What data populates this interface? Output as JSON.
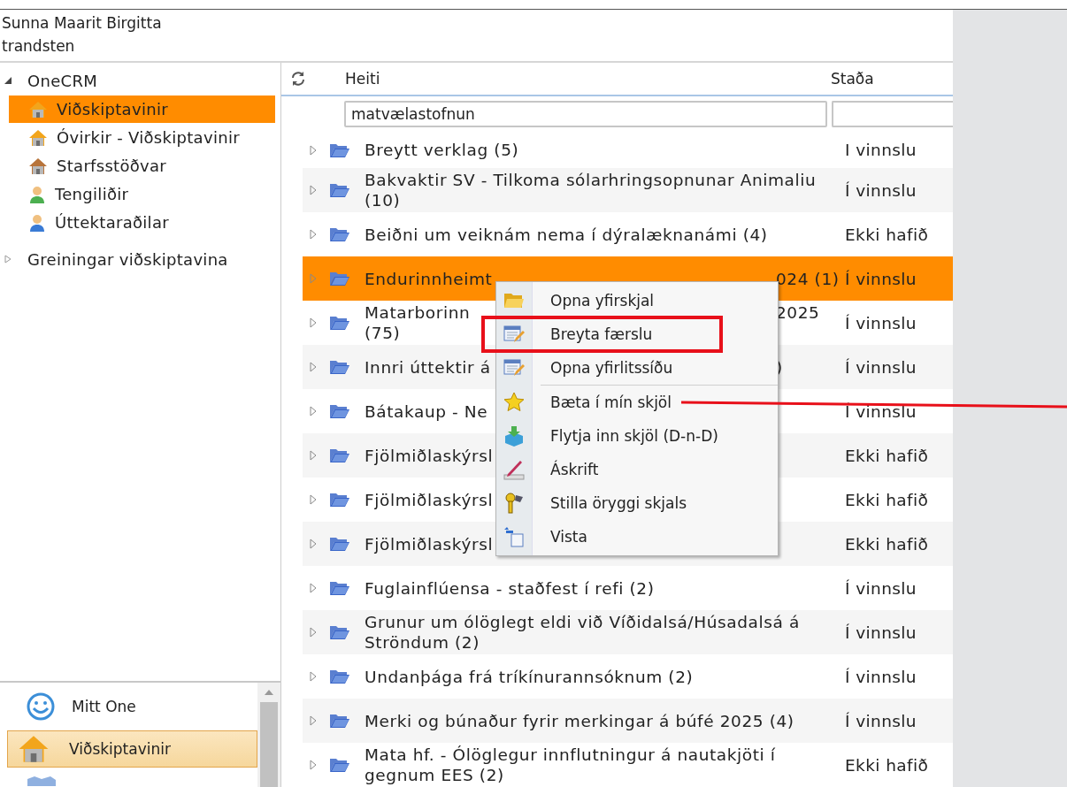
{
  "user": {
    "name_lines": [
      "Sunna Maarit Birgitta",
      "trandsten"
    ]
  },
  "tree": [
    {
      "label": "OneCRM",
      "expanded": true,
      "children": [
        {
          "label": "Viðskiptavinir",
          "kind": "house",
          "selected": true
        },
        {
          "label": "Óvirkir - Viðskiptavinir",
          "kind": "house",
          "selected": false
        },
        {
          "label": "Starfsstöðvar",
          "kind": "cottage",
          "selected": false
        },
        {
          "label": "Tengiliðir",
          "kind": "contact",
          "selected": false
        },
        {
          "label": "Úttektaraðilar",
          "kind": "auditor",
          "selected": false
        }
      ]
    },
    {
      "label": "Greiningar viðskiptavina",
      "expanded": false
    }
  ],
  "nav": [
    {
      "label": "Mitt One",
      "kind": "smiley",
      "selected": false
    },
    {
      "label": "Viðskiptavinir",
      "kind": "house",
      "selected": true
    },
    {
      "kind": "mail",
      "selected": false
    }
  ],
  "table": {
    "columns": [
      "Heiti",
      "Staða"
    ],
    "filter": {
      "value": "matvælastofnun"
    },
    "rows": [
      {
        "title": "Breytt verklag (5)",
        "status": "I vinnslu",
        "selected": false
      },
      {
        "title": "Bakvaktir SV - Tilkoma sólarhringsopnunar Animaliu (10)",
        "status": "Í vinnslu",
        "selected": false
      },
      {
        "title": "Beiðni um veiknám nema í dýralæknanámi (4)",
        "status": "Ekki hafið",
        "selected": false
      },
      {
        "title": "Endurinnheimt",
        "title_end": "024 (1)",
        "status": "Í vinnslu",
        "selected": true
      },
      {
        "title": "Matarborinn",
        "title_end": "2025",
        "title_next_line": "(75)",
        "status": "Í vinnslu",
        "selected": false
      },
      {
        "title": "Innri úttektir á",
        "title_end": ")",
        "status": "Í vinnslu",
        "selected": false
      },
      {
        "title": "Bátakaup - Ne",
        "status": "Í vinnslu",
        "selected": false
      },
      {
        "title": "Fjölmiðlaskýrsl",
        "status": "Ekki hafið",
        "selected": false
      },
      {
        "title": "Fjölmiðlaskýrsl",
        "status": "Ekki hafið",
        "selected": false
      },
      {
        "title": "Fjölmiðlaskýrsl",
        "status": "Ekki hafið",
        "selected": false
      },
      {
        "title": "Fuglainflúensa - staðfest í refi (2)",
        "status": "Í vinnslu",
        "selected": false
      },
      {
        "title": "Grunur um ólöglegt eldi við Víðidalsá/Húsadalsá á Ströndum (2)",
        "status": "Í vinnslu",
        "selected": false
      },
      {
        "title": "Undanþága frá tríkínurannsóknum (2)",
        "status": "Í vinnslu",
        "selected": false
      },
      {
        "title": "Merki og búnaður fyrir merkingar á búfé 2025 (4)",
        "status": "Í vinnslu",
        "selected": false
      },
      {
        "title": "Mata hf. - Ólöglegur innflutningur á nautakjöti í gegnum EES (2)",
        "status": "Ekki hafið",
        "selected": false
      }
    ]
  },
  "context_menu": {
    "groups": [
      [
        {
          "label": "Opna yfirskjal",
          "kind": "folder",
          "annotated": false
        },
        {
          "label": "Breyta færslu",
          "kind": "edit",
          "annotated": true
        },
        {
          "label": "Opna yfirlitssíðu",
          "kind": "edit",
          "annotated": false
        }
      ],
      [
        {
          "label": "Bæta í mín skjöl",
          "kind": "star",
          "annotated": false
        },
        {
          "label": "Flytja inn skjöl (D-n-D)",
          "kind": "import",
          "annotated": false
        },
        {
          "label": "Áskrift",
          "kind": "pen",
          "annotated": false
        },
        {
          "label": "Stilla öryggi skjals",
          "kind": "keys",
          "annotated": false
        },
        {
          "label": "Vista",
          "kind": "save",
          "annotated": false
        }
      ]
    ]
  }
}
